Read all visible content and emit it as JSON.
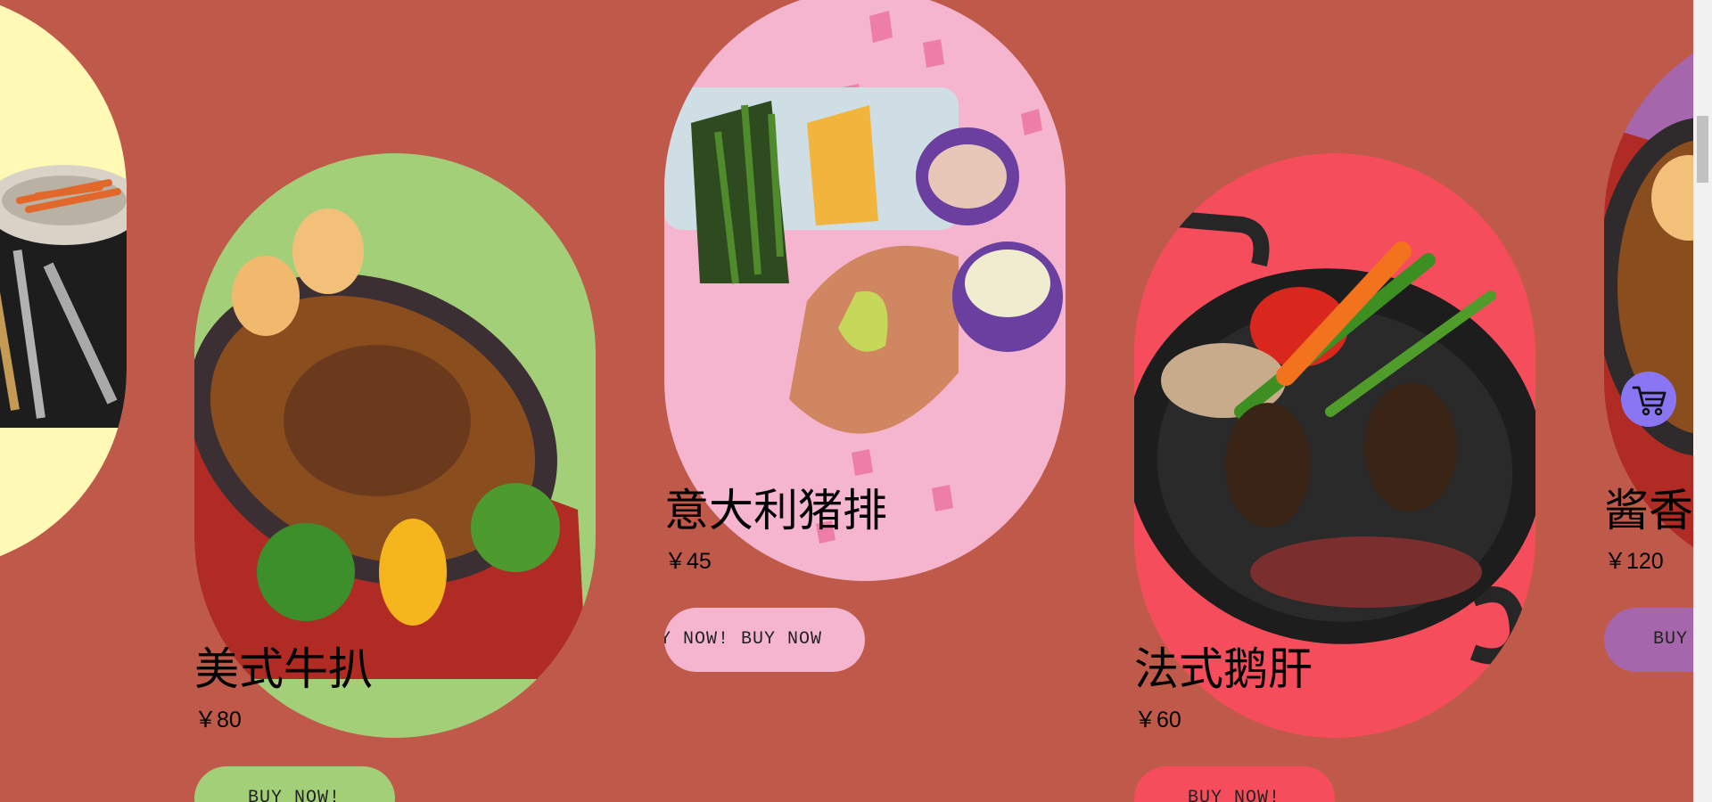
{
  "colors": {
    "page_background": "#bf5a4b",
    "accent_cart": "#8a76f2"
  },
  "products": [
    {
      "name": "",
      "price": "",
      "button": "",
      "bg_color": "#fff9b5",
      "partial": "left-edge"
    },
    {
      "name": "美式牛扒",
      "price": "￥80",
      "button": "BUY NOW!",
      "bg_color": "#a3cf79"
    },
    {
      "name": "意大利猪排",
      "price": "￥45",
      "button": "Y NOW!    BUY NOW",
      "bg_color": "#f6b5cf"
    },
    {
      "name": "法式鹅肝",
      "price": "￥60",
      "button": "BUY NOW!",
      "bg_color": "#f64d5c"
    },
    {
      "name": "酱香猪",
      "price": "￥120",
      "button": "BUY",
      "bg_color": "#a566ab",
      "partial": "right-edge"
    }
  ],
  "cart": {
    "icon": "shopping-cart-icon"
  }
}
